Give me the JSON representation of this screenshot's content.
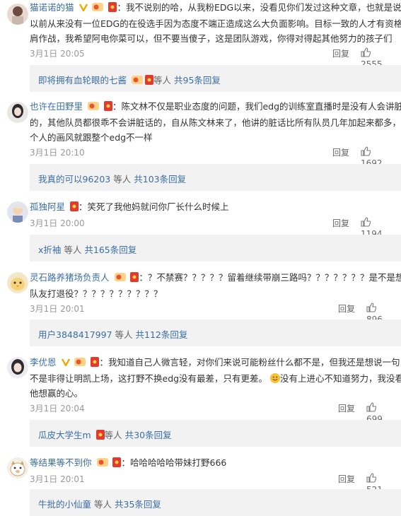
{
  "labels": {
    "reply": "回复",
    "etc": "等人",
    "total": "共",
    "replies_suffix": "条回复"
  },
  "comments": [
    {
      "user": "猫诺诺的猫",
      "lines": [
        "：我不说别的哈，从我粉EDG以来，没看见你们发过这种文章，也就是说，",
        "以前从来没有一位EDG的在役选手因为态度不端正造成这么大负面影响。目标一致的人才有资格并",
        "肩作战，我希望阿电你菜可以，但不要当傻子，这是团队游戏，你得对得起其他努力的孩子们"
      ],
      "time": "3月1日 20:05",
      "likes": "2555",
      "sub_name": "即将拥有血轮眼的七酱",
      "sub_count": "95"
    },
    {
      "user": "也许在田野里",
      "lines": [
        "：陈文林不仅是职业态度的问题，我们edg的训练室直播时是没有人会讲脏话",
        "的，其他队员都很乖不会讲脏话的，自从陈文林来了，他讲的脏话比所有队员几年加起来都多，这",
        "个人的画风就跟整个edg不一样"
      ],
      "time": "3月1日 20:10",
      "likes": "1692",
      "sub_name": "我真的可以96203",
      "sub_count": "103"
    },
    {
      "user": "孤独阿星",
      "lines": [
        "：笑死了我他妈就问你厂长什么时候上"
      ],
      "time": "3月1日 20:00",
      "likes": "1194",
      "sub_name": "x折袖",
      "sub_count": "165"
    },
    {
      "user": "灵石路养猪场负责人",
      "lines": [
        "：？不禁赛？？？？？留着继续带崩三路吗？？？？？？？是不是想把",
        "队友打退役？？？？？？？？？？"
      ],
      "time": "3月1日 20:01",
      "likes": "896",
      "sub_name": "用户3848417997",
      "sub_count": "112"
    },
    {
      "user": "李优恩",
      "lines": [
        "：我知道自己人微言轻，对你们来说可能粉丝什么都不是，但我还是想说一句，我",
        "不是非得让明凯上场，这打野不换edg没有最差，只有更差。",
        "他想赢的心。"
      ],
      "line2_tail": "没有上进心不知道努力，我没看到",
      "time": "3月1日 20:04",
      "likes": "699",
      "sub_name": "瓜皮大学生m",
      "sub_count": "30"
    },
    {
      "user": "等结果等不到你",
      "lines": [
        "：哈哈哈哈哈带妹打野666"
      ],
      "time": "3月1日 20:01",
      "likes": "521",
      "sub_name": "牛批的小仙童",
      "sub_count": "35"
    }
  ]
}
